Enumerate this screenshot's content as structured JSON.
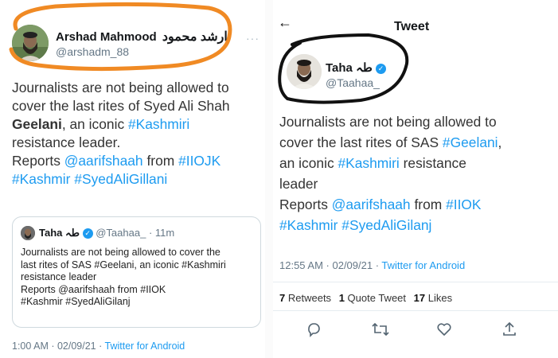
{
  "left": {
    "author": {
      "name": "Arshad Mahmood",
      "name_urdu": "ارشد محمود",
      "handle": "@arshadm_88"
    },
    "tweet": {
      "line1": "Journalists are not being allowed to",
      "line2": "cover the last rites of Syed Ali Shah",
      "line3_bold": "Geelani",
      "line3_rest": ", an iconic ",
      "line3_hash": "#Kashmiri",
      "line4": "resistance leader.",
      "line5_start": "Reports ",
      "line5_mention": "@aarifshaah",
      "line5_mid": " from ",
      "line5_hash": "#IIOJK",
      "line6_hash1": "#Kashmir",
      "line6_hash2": "#SyedAliGillani"
    },
    "quote": {
      "name": "Taha",
      "name_urdu": "طہ",
      "handle": "@Taahaa_",
      "time": "· 11m",
      "line1": "Journalists are not being allowed to cover the",
      "line2": "last rites of SAS #Geelani, an iconic #Kashmiri",
      "line3": "resistance leader",
      "line4": "Reports @aarifshaah from #IIOK",
      "line5": "#Kashmir #SyedAliGilanj"
    },
    "meta": {
      "time": "1:00 AM · 02/09/21 · ",
      "source": "Twitter for Android"
    }
  },
  "right": {
    "header": {
      "title": "Tweet"
    },
    "author": {
      "name": "Taha",
      "name_urdu": "طہ",
      "handle": "@Taahaa_"
    },
    "tweet": {
      "line1": "Journalists are not being allowed to",
      "line2_start": "cover the last rites of SAS ",
      "line2_hash": "#Geelani",
      "line2_end": ",",
      "line3_start": "an iconic ",
      "line3_hash": "#Kashmiri",
      "line3_end": " resistance",
      "line4": "leader",
      "line5_start": "Reports ",
      "line5_mention": "@aarifshaah",
      "line5_mid": " from ",
      "line5_hash": "#IIOK",
      "line6_hash1": "#Kashmir",
      "line6_hash2": "#SyedAliGilanj"
    },
    "meta": {
      "time": "12:55 AM · 02/09/21 · ",
      "source": "Twitter for Android"
    },
    "stats": {
      "retweets_count": "7",
      "retweets_label": "Retweets",
      "quotes_count": "1",
      "quotes_label": "Quote Tweet",
      "likes_count": "17",
      "likes_label": "Likes"
    },
    "actions": [
      "reply-icon",
      "retweet-icon",
      "like-icon",
      "share-icon"
    ]
  },
  "colors": {
    "accent": "#1d9bf0",
    "annotation_orange": "#f08a24",
    "annotation_black": "#111111"
  }
}
